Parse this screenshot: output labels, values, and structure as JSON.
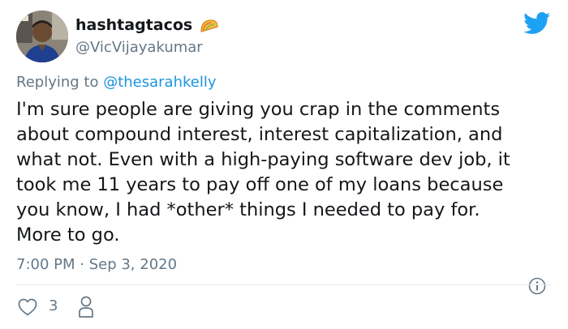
{
  "author": {
    "display_name": "hashtagtacos",
    "username": "@VicVijayakumar",
    "avatar_icon": "avatar",
    "badge_icon": "taco-icon"
  },
  "reply": {
    "prefix": "Replying to ",
    "handle": "@thesarahkelly"
  },
  "tweet": {
    "text": "I'm sure people are giving you crap in the comments\nabout compound interest, interest capitalization, and\nwhat not. Even with a high-paying software dev job, it\ntook me 11 years to pay off one of my loans because\nyou know, I had *other* things I needed to pay for.\nMore to go.",
    "timestamp": "7:00 PM · Sep 3, 2020"
  },
  "actions": {
    "like_count": "3"
  },
  "colors": {
    "twitter_blue": "#1da1f2",
    "link": "#1b95e0",
    "muted": "#657786",
    "text": "#14171a",
    "divider": "#e1e8ed",
    "taco_orange": "#f4a540"
  }
}
